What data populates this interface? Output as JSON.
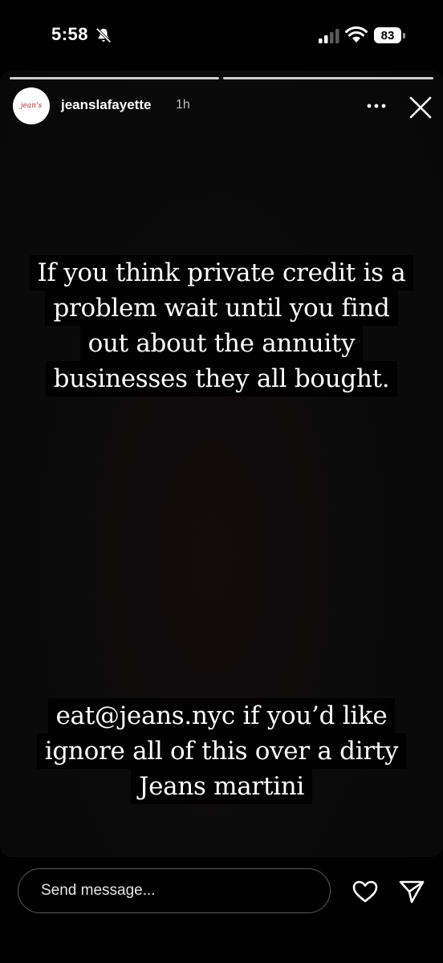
{
  "status_bar": {
    "time": "5:58",
    "battery_level": "83",
    "icons": [
      "bell-slash-icon",
      "signal-icon",
      "wifi-icon",
      "battery-icon"
    ]
  },
  "story": {
    "progress_segments": 2,
    "active_segment": 2,
    "username": "jeanslafayette",
    "time_ago": "1h",
    "avatar_text": "jean's",
    "caption_top_lines": [
      "If you think private credit is a",
      "problem wait until you find",
      "out about the annuity",
      "businesses they all bought."
    ],
    "caption_bottom_lines": [
      "eat@jeans.nyc if you’d like",
      "ignore all of this over a dirty",
      "Jeans martini"
    ]
  },
  "composer": {
    "placeholder": "Send message...",
    "value": ""
  },
  "colors": {
    "background": "#000000",
    "story_background": "#0b0b0b",
    "progress": "#cfcfcf",
    "avatar_logo": "#b33030"
  }
}
